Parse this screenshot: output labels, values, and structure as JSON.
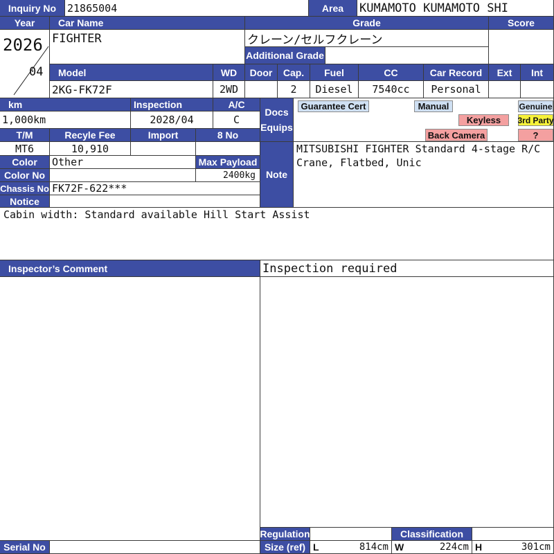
{
  "inquiry": {
    "label": "Inquiry No",
    "value": "21865004"
  },
  "area": {
    "label": "Area",
    "value": "KUMAMOTO KUMAMOTO SHI"
  },
  "year": {
    "label": "Year",
    "value": "2026",
    "month": "04"
  },
  "car_name": {
    "label": "Car Name",
    "value": "FIGHTER"
  },
  "grade": {
    "label": "Grade",
    "value": "クレーン/セルフクレーン",
    "additional_label": "Additional Grade"
  },
  "score": {
    "label": "Score"
  },
  "row_labels": {
    "model": "Model",
    "wd": "WD",
    "door": "Door",
    "cap": "Cap.",
    "fuel": "Fuel",
    "cc": "CC",
    "car_record": "Car Record",
    "ext": "Ext",
    "int": "Int"
  },
  "row_values": {
    "model": "2KG-FK72F",
    "wd": "2WD",
    "cap": "2",
    "fuel": "Diesel",
    "cc": "7540cc",
    "car_record": "Personal"
  },
  "km": {
    "label": "km",
    "value": "1,000km"
  },
  "inspection": {
    "label": "Inspection",
    "value": "2028/04"
  },
  "ac": {
    "label": "A/C",
    "value": "C"
  },
  "docs": {
    "label_line1": "Docs",
    "label_line2": "Equips"
  },
  "badges": {
    "guarantee": "Guarantee Cert",
    "manual": "Manual",
    "genuine": "Genuine",
    "keyless": "Keyless",
    "third_party": "3rd Party",
    "back_camera": "Back Camera",
    "unknown": "?"
  },
  "tm": {
    "label": "T/M",
    "value": "MT6"
  },
  "recycle": {
    "label": "Recyle Fee",
    "value": "10,910"
  },
  "import": {
    "label": "Import"
  },
  "eight_no": {
    "label": "8 No"
  },
  "color": {
    "label": "Color",
    "value": "Other"
  },
  "max_payload": {
    "label": "Max Payload",
    "value": "2400kg"
  },
  "color_no": {
    "label": "Color No"
  },
  "chassis": {
    "label": "Chassis No",
    "value": "FK72F-622***"
  },
  "note": {
    "label": "Note",
    "value": "MITSUBISHI FIGHTER Standard 4-stage R/C Crane, Flatbed, Unic"
  },
  "notice": {
    "label": "Notice",
    "value": "Cabin width: Standard available Hill Start Assist"
  },
  "inspector": {
    "label": "Inspector’s Comment",
    "value": "Inspection required"
  },
  "regulation": {
    "label": "Regulation",
    "size_label": "Size (ref)"
  },
  "classification": {
    "label": "Classification"
  },
  "size": {
    "l_label": "L",
    "l_value": "814cm",
    "w_label": "W",
    "w_value": "224cm",
    "h_label": "H",
    "h_value": "301cm"
  },
  "serial": {
    "label": "Serial No"
  },
  "colors": {
    "header_bg": "#3d4ea3",
    "badge_blue": "#cfe0f3",
    "badge_pink": "#f4a0a0",
    "badge_yellow": "#f7f23a"
  }
}
